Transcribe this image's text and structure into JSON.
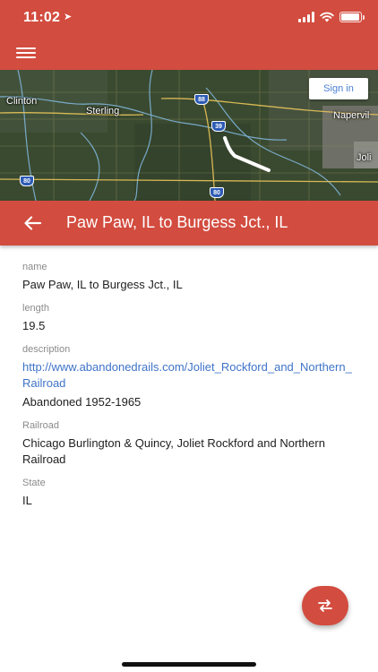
{
  "status_bar": {
    "time": "11:02",
    "location_glyph": "➤"
  },
  "app_bar": {
    "menu_icon": "hamburger-menu-icon"
  },
  "map": {
    "sign_in_label": "Sign in",
    "cities": [
      "Clinton",
      "Sterling",
      "Napervil",
      "Joli"
    ],
    "highway_shields": [
      "88",
      "39",
      "80",
      "80"
    ]
  },
  "detail": {
    "title": "Paw Paw, IL to Burgess Jct., IL",
    "fields": [
      {
        "label": "name",
        "value": "Paw Paw, IL to Burgess Jct., IL"
      },
      {
        "label": "length",
        "value": "19.5"
      },
      {
        "label": "description",
        "link": "http://www.abandonedrails.com/Joliet_Rockford_and_Northern_Railroad",
        "value": "Abandoned 1952-1965"
      },
      {
        "label": "Railroad",
        "value": "Chicago Burlington & Quincy, Joliet Rockford and Northern Railroad"
      },
      {
        "label": "State",
        "value": "IL"
      }
    ]
  },
  "fab": {
    "icon": "swap-arrows-icon"
  },
  "colors": {
    "primary": "#d24c3f",
    "link": "#3f73c8",
    "label": "#8a8a8a"
  }
}
